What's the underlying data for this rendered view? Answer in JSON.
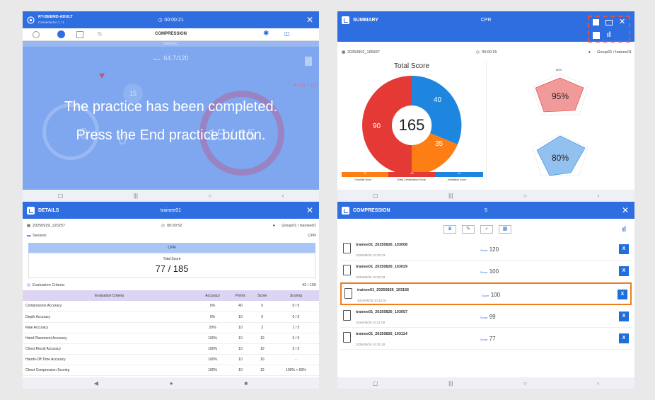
{
  "panel1": {
    "title": "RT-BEEMD-ADULT",
    "subtitle": "Connected to 1 / 1",
    "timer": "00:00:21",
    "toolbar_label": "COMPRESSION",
    "trainee_band": "trainee01",
    "score_label": "Score",
    "score_value": "64.7/120",
    "heart_right": "15 / 15",
    "bubble_number": "15",
    "big_left": "0",
    "big_mid": "0",
    "big_right": "15 / 15",
    "msg_line1": "The practice has been completed.",
    "msg_line2": "Press the End practice button."
  },
  "panel2": {
    "title": "SUMMARY",
    "center": "CPR",
    "session_id": "20250902_165837",
    "timer": "00:00:15",
    "group": "Group01 / trainee01",
    "total_score_label": "Total Score",
    "total_score": "165",
    "donut_values": [
      "40",
      "35",
      "90"
    ],
    "donut_colors": [
      "#1f86e0",
      "#fd7e14",
      "#e53935"
    ],
    "legend": [
      "Checklist Score",
      "Chest Compression Score",
      "Ventilation Score"
    ],
    "legend_values": [
      "35",
      "90",
      "40"
    ],
    "radar_top_value": "95%",
    "radar_top_label": "80%",
    "radar_bottom_value": "80%"
  },
  "panel3": {
    "title": "DETAILS",
    "center": "trainee01",
    "session_id": "20250929_120257",
    "timer": "00:00:52",
    "group": "Group01 / trainee01",
    "session_label": "Session",
    "session_right": "CPR",
    "cpr": "CPR",
    "total_score_label": "Total Score",
    "total_score": "77 / 185",
    "eval_label": "Evaluation Criteria",
    "eval_right": "42 / 150",
    "headers": [
      "Evaluation Criteria",
      "Accuracy",
      "Points",
      "Score",
      "Scoring"
    ],
    "rows": [
      [
        "Compression Accuracy",
        "0%",
        "40",
        "0",
        "0 / 5"
      ],
      [
        "Depth Accuracy",
        "0%",
        "10",
        "0",
        "0 / 5"
      ],
      [
        "Rate Accuracy",
        "20%",
        "10",
        "2",
        "1 / 5"
      ],
      [
        "Hand Placement Accuracy",
        "100%",
        "10",
        "10",
        "5 / 5"
      ],
      [
        "Chest Recoil Accuracy",
        "100%",
        "10",
        "10",
        "5 / 5"
      ],
      [
        "Hands-Off Time Accuracy",
        "100%",
        "10",
        "10",
        "-"
      ]
    ],
    "partial_row": [
      "Chest Compression Scoring",
      "100%",
      "10",
      "10",
      "100% > 60%"
    ]
  },
  "panel4": {
    "title": "COMPRESSION",
    "center": "5",
    "records": [
      {
        "name": "trainee01_20250826_103008",
        "date": "2025/08/26 10:30:13",
        "score": "120"
      },
      {
        "name": "trainee01_20250826_103029",
        "date": "2025/08/26 10:30:33",
        "score": "100"
      },
      {
        "name": "trainee01_20250826_103156",
        "date": "2025/08/26 10:32:01",
        "score": "100"
      },
      {
        "name": "trainee01_20250826_103057",
        "date": "2025/08/26 10:31:09",
        "score": "99"
      },
      {
        "name": "trainee01_20250826_103114",
        "date": "2025/08/26 10:31:18",
        "score": "77"
      }
    ],
    "score_label": "Score",
    "selected_index": 2
  },
  "colors": {
    "accent": "#2f6ee0",
    "overlay": "#7fa7ef",
    "highlight": "#f07d1a"
  }
}
